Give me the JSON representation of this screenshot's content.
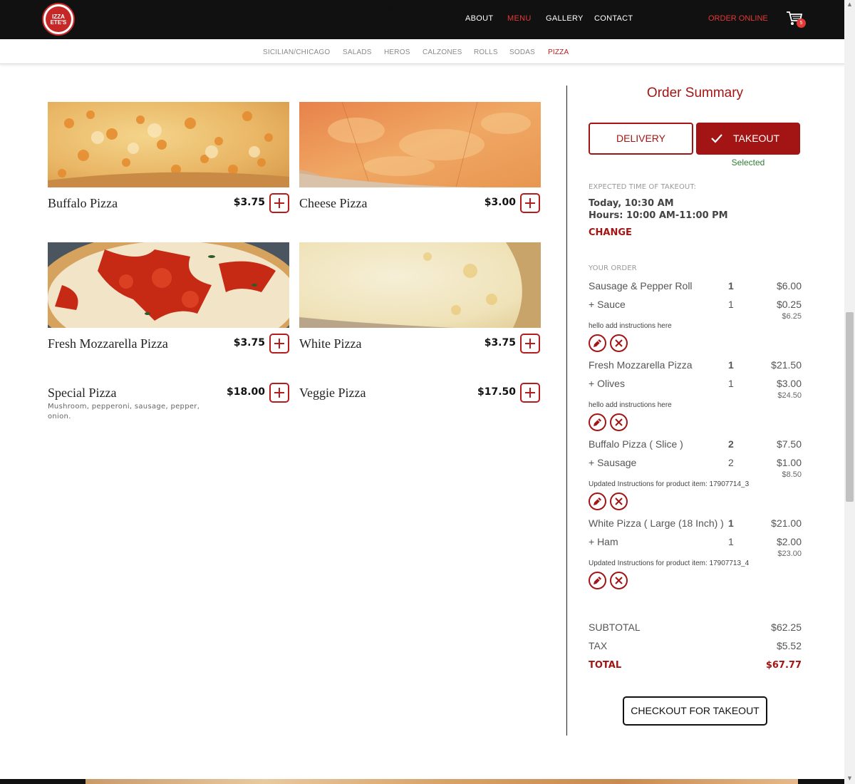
{
  "header": {
    "logo_text": "IZZA ETE'S",
    "heading": "Menu",
    "nav": [
      "ABOUT",
      "MENU",
      "GALLERY",
      "CONTACT"
    ],
    "active_nav": "MENU",
    "order_online": "ORDER ONLINE",
    "cart_count": "5"
  },
  "categories": [
    "SICILIAN/CHICAGO",
    "SALADS",
    "HEROS",
    "CALZONES",
    "ROLLS",
    "SODAS",
    "PIZZA"
  ],
  "active_category": "PIZZA",
  "products": [
    {
      "name": "Buffalo Pizza",
      "price": "$3.75",
      "image": "buffalo-pizza-photo"
    },
    {
      "name": "Cheese Pizza",
      "price": "$3.00",
      "image": "cheese-pizza-photo"
    },
    {
      "name": "Fresh Mozzarella Pizza",
      "price": "$3.75",
      "image": "fresh-mozzarella-pizza-photo"
    },
    {
      "name": "White Pizza",
      "price": "$3.75",
      "image": "white-pizza-photo"
    },
    {
      "name": "Special Pizza",
      "price": "$18.00",
      "desc_line1": "Mushroom, pepperoni, sausage, pepper,",
      "desc_line2": "onion."
    },
    {
      "name": "Veggie Pizza",
      "price": "$17.50"
    }
  ],
  "summary": {
    "title": "Order Summary",
    "delivery_label": "DELIVERY",
    "takeout_label": "TAKEOUT",
    "selected_label": "Selected",
    "expected_label": "EXPECTED TIME OF TAKEOUT:",
    "time_today": "Today, 10:30 AM",
    "time_hours": "Hours: 10:00 AM-11:00 PM",
    "change_label": "CHANGE",
    "your_order_label": "YOUR ORDER",
    "items": [
      {
        "name": "Sausage & Pepper Roll",
        "qty": "1",
        "price": "$6.00",
        "mod_name": "+ Sauce",
        "mod_qty": "1",
        "mod_price": "$0.25",
        "total": "$6.25",
        "instructions": "hello add instructions here"
      },
      {
        "name": "Fresh Mozzarella Pizza",
        "qty": "1",
        "price": "$21.50",
        "mod_name": "+ Olives",
        "mod_qty": "1",
        "mod_price": "$3.00",
        "total": "$24.50",
        "instructions": "hello add instructions here"
      },
      {
        "name": "Buffalo Pizza ( Slice )",
        "qty": "2",
        "price": "$7.50",
        "mod_name": "+ Sausage",
        "mod_qty": "2",
        "mod_price": "$1.00",
        "total": "$8.50",
        "instructions": "Updated Instructions for product item: 17907714_3"
      },
      {
        "name": "White Pizza ( Large (18 Inch) )",
        "qty": "1",
        "price": "$21.00",
        "mod_name": "+ Ham",
        "mod_qty": "1",
        "mod_price": "$2.00",
        "total": "$23.00",
        "instructions": "Updated Instructions for product item: 17907713_4"
      }
    ],
    "subtotal_label": "SUBTOTAL",
    "subtotal": "$62.25",
    "tax_label": "TAX",
    "tax": "$5.52",
    "total_label": "TOTAL",
    "total": "$67.77",
    "checkout_label": "CHECKOUT FOR TAKEOUT"
  },
  "colors": {
    "brand": "#a31515",
    "nav_active": "#e53935",
    "selected_green": "#2e7d32"
  }
}
